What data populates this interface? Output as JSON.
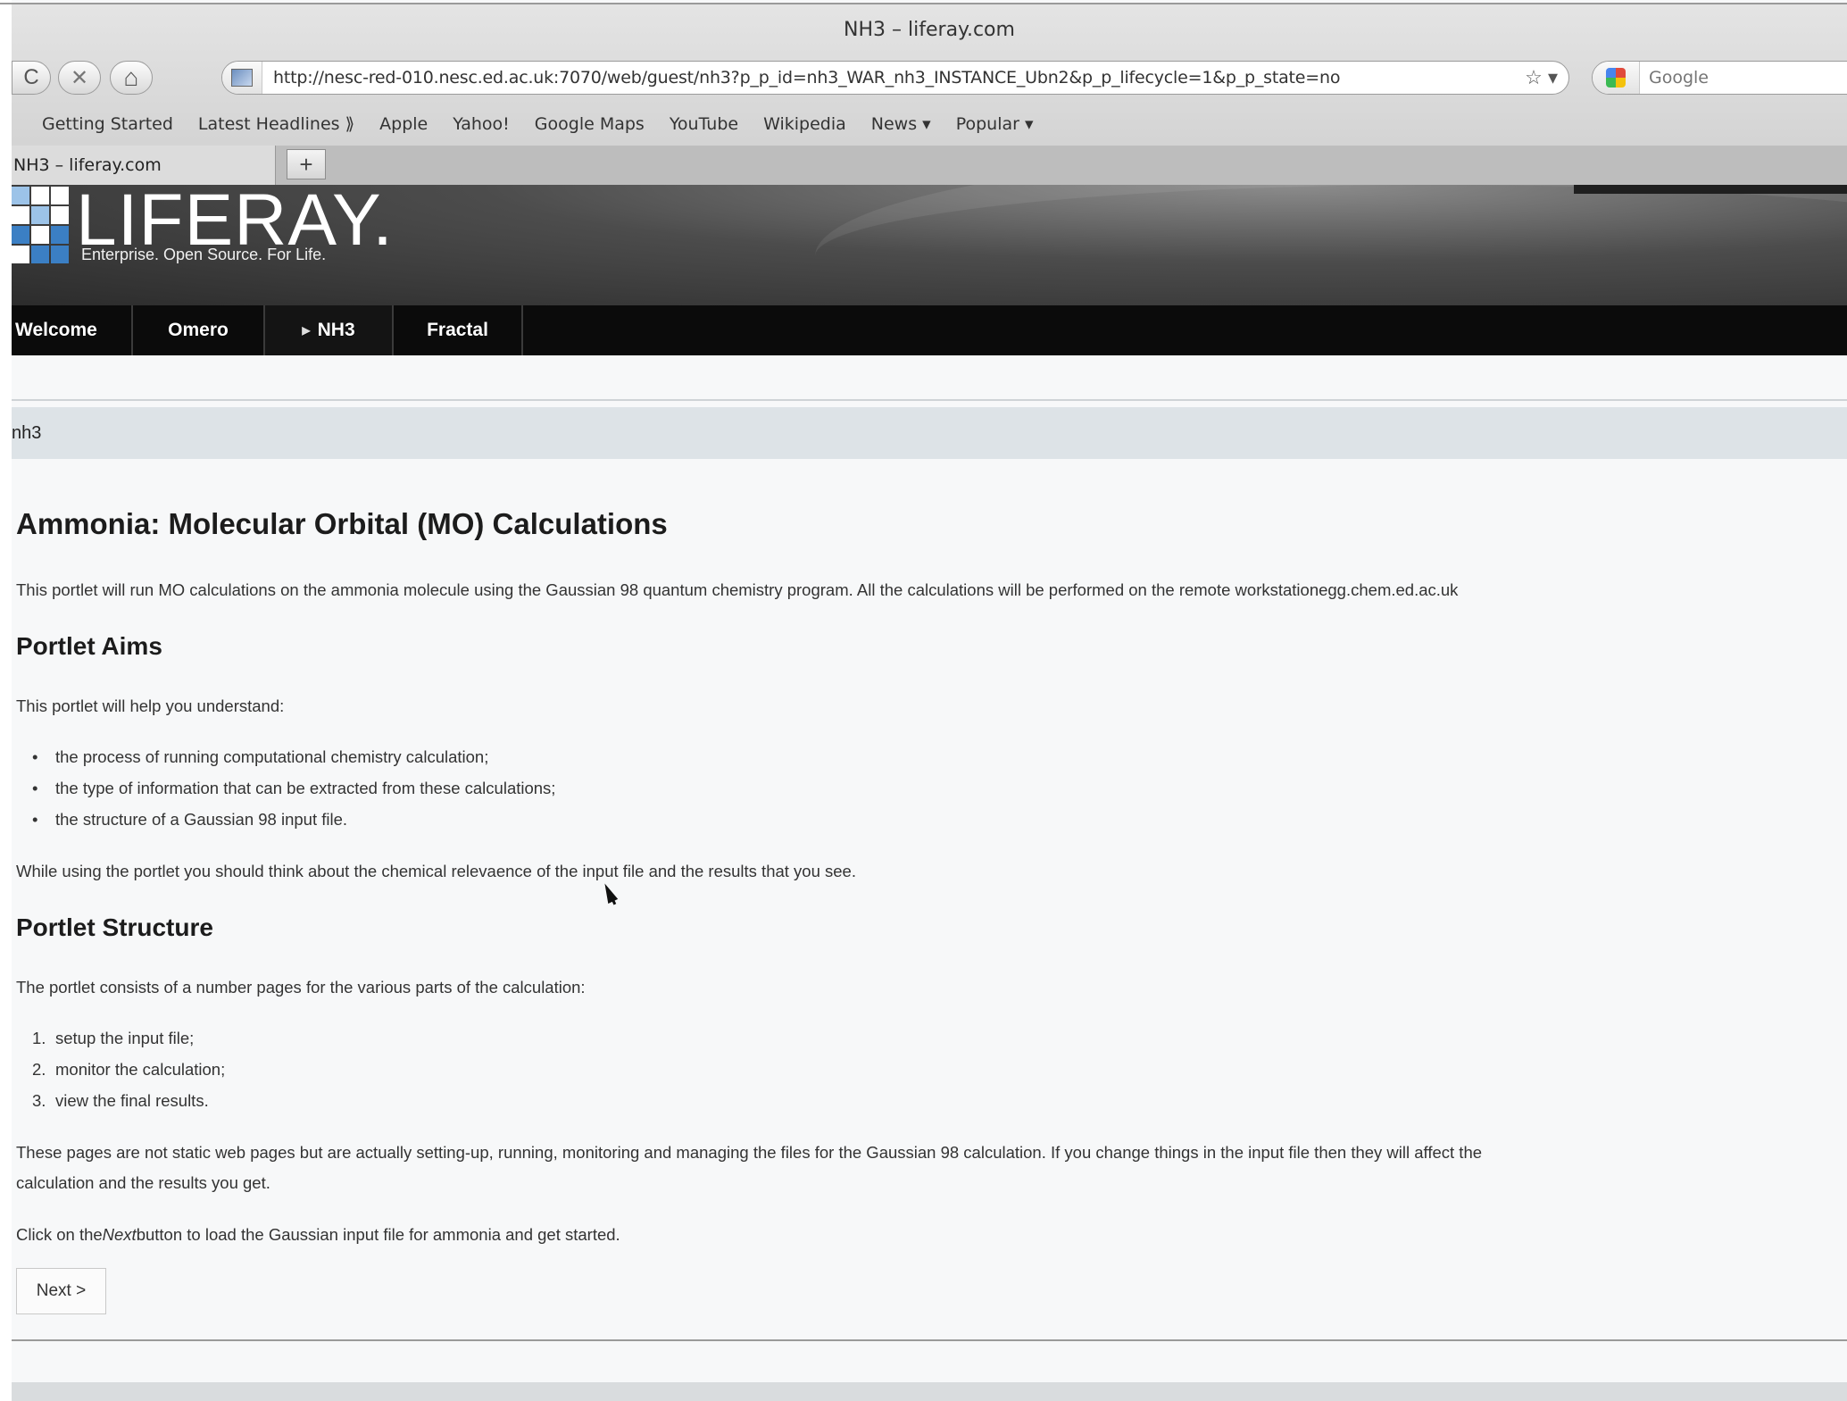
{
  "window": {
    "title": "NH3 – liferay.com"
  },
  "toolbar": {
    "reload_glyph": "C",
    "stop_glyph": "✕",
    "home_glyph": "⌂",
    "url": "http://nesc-red-010.nesc.ed.ac.uk:7070/web/guest/nh3?p_p_id=nh3_WAR_nh3_INSTANCE_Ubn2&p_p_lifecycle=1&p_p_state=no",
    "bookmark_star": "☆",
    "url_dropdown": "▾",
    "search_placeholder": "Google"
  },
  "bookmarks": [
    "Getting Started",
    "Latest Headlines ⟫",
    "Apple",
    "Yahoo!",
    "Google Maps",
    "YouTube",
    "Wikipedia",
    "News ▾",
    "Popular ▾"
  ],
  "tabs": {
    "active_label": "NH3 – liferay.com",
    "new_tab_glyph": "+"
  },
  "site": {
    "logo_text": "LIFERAY.",
    "tagline": "Enterprise. Open Source. For Life."
  },
  "nav": [
    {
      "label": "Welcome",
      "active": false
    },
    {
      "label": "Omero",
      "active": false
    },
    {
      "label": "NH3",
      "active": true
    },
    {
      "label": "Fractal",
      "active": false
    }
  ],
  "portlet": {
    "title": "nh3",
    "heading": "Ammonia: Molecular Orbital (MO) Calculations",
    "intro": "This portlet will run MO calculations on the ammonia molecule using the Gaussian 98 quantum chemistry program. All the calculations will be performed on the remote workstationegg.chem.ed.ac.uk",
    "aims_heading": "Portlet Aims",
    "aims_intro": "This portlet will help you understand:",
    "aims": [
      "the process of running computational chemistry calculation;",
      "the type of information that can be extracted from these calculations;",
      "the structure of a Gaussian 98 input file."
    ],
    "aims_note": "While using the portlet you should think about the chemical relevaence of the input file and the results that you see.",
    "structure_heading": "Portlet Structure",
    "structure_intro": "The portlet consists of a number pages for the various parts of the calculation:",
    "steps": [
      "setup the input file;",
      "monitor the calculation;",
      "view the final results."
    ],
    "steps_numbers": [
      "1.",
      "2.",
      "3."
    ],
    "dynamic_note_1": "These pages are not static web pages but are actually setting-up, running, monitoring and managing the files for the Gaussian 98 calculation. If you change things in the input file then they will affect the",
    "dynamic_note_2": "calculation and the results you get.",
    "click_note_pre": "Click on the",
    "click_note_em": "Next",
    "click_note_post": "button to load the Gaussian input file for ammonia and get started.",
    "next_button": "Next >"
  }
}
